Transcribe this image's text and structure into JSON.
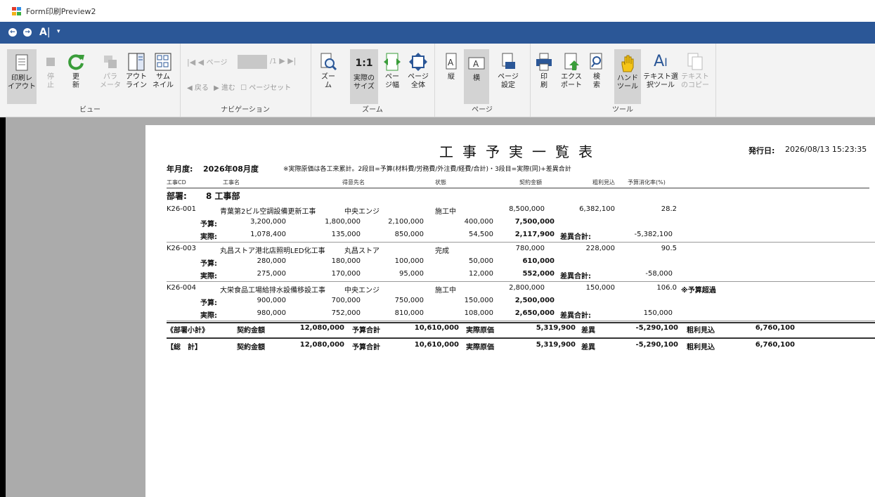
{
  "window": {
    "title": "Form印刷Preview2"
  },
  "qat": {
    "back": "←",
    "forward": "→",
    "text_select": "A",
    "dropdown": "▾"
  },
  "ribbon": {
    "groups": {
      "view": "ビュー",
      "navigation": "ナビゲーション",
      "zoom": "ズーム",
      "page": "ページ",
      "tools": "ツール"
    },
    "view": {
      "print_layout": [
        "印刷レ",
        "イアウト"
      ],
      "stop": [
        "停",
        "止"
      ],
      "refresh": [
        "更",
        "新"
      ],
      "params": [
        "パラ",
        "メータ"
      ],
      "outline": [
        "アウト",
        "ライン"
      ],
      "thumb": [
        "サム",
        "ネイル"
      ]
    },
    "nav": {
      "page_label": "ページ",
      "page_of": "/1",
      "back": "戻る",
      "forward": "進む",
      "page_set": "ページセット",
      "page_value": ""
    },
    "zoom": {
      "zoom": [
        "ズー",
        "ム"
      ],
      "actual": [
        "実際の",
        "サイズ"
      ],
      "one_to_one": "1:1",
      "page_width": [
        "ペー",
        "ジ幅"
      ],
      "whole": [
        "ページ",
        "全体"
      ]
    },
    "page": {
      "portrait": "縦",
      "landscape": "横",
      "setup": [
        "ページ",
        "設定"
      ]
    },
    "tools": {
      "print": [
        "印",
        "刷"
      ],
      "export": [
        "エクス",
        "ポート"
      ],
      "search": [
        "検",
        "索"
      ],
      "hand": [
        "ハンド",
        "ツール"
      ],
      "textsel": [
        "テキスト選",
        "択ツール"
      ],
      "copy": [
        "テキスト",
        "のコピー"
      ]
    }
  },
  "report": {
    "title": "工事予実一覧表",
    "issue_label": "発行日:",
    "issue_date": "2026/08/13 15:23:35",
    "month_label": "年月度:",
    "month_value": "2026年08月度",
    "note": "※実際原価は各工来累計。2段目=予算(材料費/労務費/外注費/経費/合計)・3段目=実際(同)+差異合計",
    "headers": [
      "工事CD",
      "工事名",
      "得意先名",
      "状態",
      "契約金額",
      "粗利見込",
      "予算消化率(%)"
    ],
    "dept_label": "部署:",
    "dept_value": "8 工事部",
    "budget_label": "予算:",
    "actual_label": "実際:",
    "diff_label": "差異合計:",
    "rows": [
      {
        "cd": "K26-001",
        "name": "青葉第2ビル空調設備更新工事",
        "client": "中央エンジ",
        "status": "施工中",
        "contract": "8,500,000",
        "profit": "6,382,100",
        "rate": "28.2",
        "flag": "",
        "budget": [
          "3,200,000",
          "1,800,000",
          "2,100,000",
          "400,000",
          "7,500,000"
        ],
        "actual": [
          "1,078,400",
          "135,000",
          "850,000",
          "54,500",
          "2,117,900"
        ],
        "diff": "-5,382,100"
      },
      {
        "cd": "K26-003",
        "name": "丸昌ストア港北店照明LED化工事",
        "client": "丸昌ストア",
        "status": "完成",
        "contract": "780,000",
        "profit": "228,000",
        "rate": "90.5",
        "flag": "",
        "budget": [
          "280,000",
          "180,000",
          "100,000",
          "50,000",
          "610,000"
        ],
        "actual": [
          "275,000",
          "170,000",
          "95,000",
          "12,000",
          "552,000"
        ],
        "diff": "-58,000"
      },
      {
        "cd": "K26-004",
        "name": "大栄食品工場給排水設備移設工事",
        "client": "中央エンジ",
        "status": "施工中",
        "contract": "2,800,000",
        "profit": "150,000",
        "rate": "106.0",
        "flag": "※予算超過",
        "budget": [
          "900,000",
          "700,000",
          "750,000",
          "150,000",
          "2,500,000"
        ],
        "actual": [
          "980,000",
          "752,000",
          "810,000",
          "108,000",
          "2,650,000"
        ],
        "diff": "150,000"
      }
    ],
    "subtotal": {
      "label": "《部署小計》",
      "contract_label": "契約金額",
      "contract": "12,080,000",
      "budget_label": "予算合計",
      "budget": "10,610,000",
      "actual_label": "実際原価",
      "actual": "5,319,900",
      "diff_label": "差異",
      "diff": "-5,290,100",
      "profit_label": "粗利見込",
      "profit": "6,760,100"
    },
    "total": {
      "label": "【総　計】",
      "contract_label": "契約金額",
      "contract": "12,080,000",
      "budget_label": "予算合計",
      "budget": "10,610,000",
      "actual_label": "実際原価",
      "actual": "5,319,900",
      "diff_label": "差異",
      "diff": "-5,290,100",
      "profit_label": "粗利見込",
      "profit": "6,760,100"
    }
  }
}
